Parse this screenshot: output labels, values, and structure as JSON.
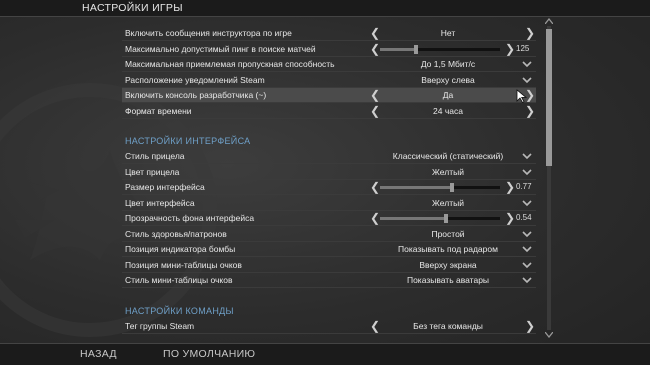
{
  "window": {
    "title": "НАСТРОЙКИ ИГРЫ"
  },
  "rows": [
    {
      "label": "Включить сообщения инструктора по игре",
      "value": "Нет",
      "control": "arrows"
    },
    {
      "label": "Максимально допустимый пинг в поиске матчей",
      "value": "125",
      "control": "slider",
      "level": 0.3
    },
    {
      "label": "Максимальная приемлемая пропускная способность",
      "value": "До 1,5 Мбит/с",
      "control": "dropdown"
    },
    {
      "label": "Расположение уведомлений Steam",
      "value": "Вверху слева",
      "control": "dropdown"
    },
    {
      "label": "Включить консоль разработчика (~)",
      "value": "Да",
      "control": "arrows",
      "active": true
    },
    {
      "label": "Формат времени",
      "value": "24 часа",
      "control": "arrows"
    }
  ],
  "sections": {
    "interface": "НАСТРОЙКИ ИНТЕРФЕЙСА",
    "team": "НАСТРОЙКИ КОМАНДЫ"
  },
  "interface_rows": [
    {
      "label": "Стиль прицела",
      "value": "Классический (статический)",
      "control": "dropdown"
    },
    {
      "label": "Цвет прицела",
      "value": "Желтый",
      "control": "dropdown"
    },
    {
      "label": "Размер интерфейса",
      "value": "0.77",
      "control": "slider",
      "level": 0.6
    },
    {
      "label": "Цвет интерфейса",
      "value": "Желтый",
      "control": "dropdown"
    },
    {
      "label": "Прозрачность фона интерфейса",
      "value": "0.54",
      "control": "slider",
      "level": 0.55
    },
    {
      "label": "Стиль здоровья/патронов",
      "value": "Простой",
      "control": "dropdown"
    },
    {
      "label": "Позиция индикатора бомбы",
      "value": "Показывать под радаром",
      "control": "dropdown"
    },
    {
      "label": "Позиция мини-таблицы очков",
      "value": "Вверху экрана",
      "control": "dropdown"
    },
    {
      "label": "Стиль мини-таблицы очков",
      "value": "Показывать аватары",
      "control": "dropdown"
    }
  ],
  "team_rows": [
    {
      "label": "Тег группы Steam",
      "value": "Без тега команды",
      "control": "arrows"
    }
  ],
  "bottom": {
    "back": "НАЗАД",
    "defaults": "ПО УМОЛЧАНИЮ"
  },
  "scroll": {
    "position": 0.0,
    "visible_fraction": 0.45
  },
  "colors": {
    "section": "#6fa0c8",
    "background": "#2a2a2a",
    "bar": "#1b1b1b"
  },
  "icons": {
    "left": "arrow-left-icon",
    "right": "arrow-right-icon",
    "dropdown": "chevron-down-icon"
  }
}
